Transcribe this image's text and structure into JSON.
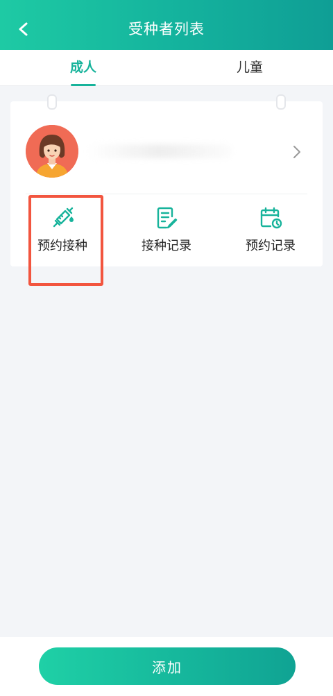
{
  "header": {
    "title": "受种者列表"
  },
  "tabs": [
    {
      "label": "成人",
      "active": true
    },
    {
      "label": "儿童",
      "active": false
    }
  ],
  "card": {
    "actions": [
      {
        "label": "预约接种",
        "icon": "syringe-icon"
      },
      {
        "label": "接种记录",
        "icon": "record-edit-icon"
      },
      {
        "label": "预约记录",
        "icon": "calendar-clock-icon"
      }
    ]
  },
  "footer": {
    "add_label": "添加"
  },
  "colors": {
    "accent": "#17b39b",
    "highlight": "#f2553f",
    "avatar_bg": "#f06b55"
  }
}
